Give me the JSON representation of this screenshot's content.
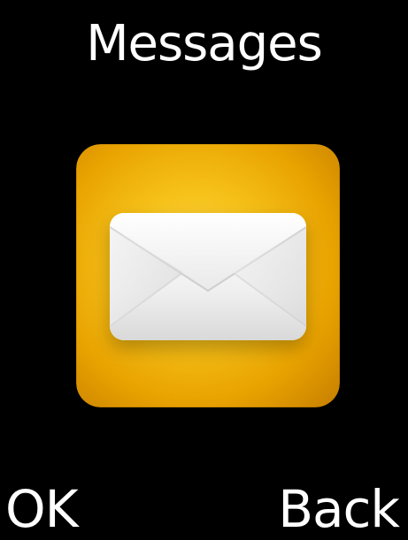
{
  "screen": {
    "title": "Messages",
    "icon": "envelope-icon",
    "accent_color": "#F4B400"
  },
  "softkeys": {
    "left_label": "OK",
    "right_label": "Back"
  }
}
